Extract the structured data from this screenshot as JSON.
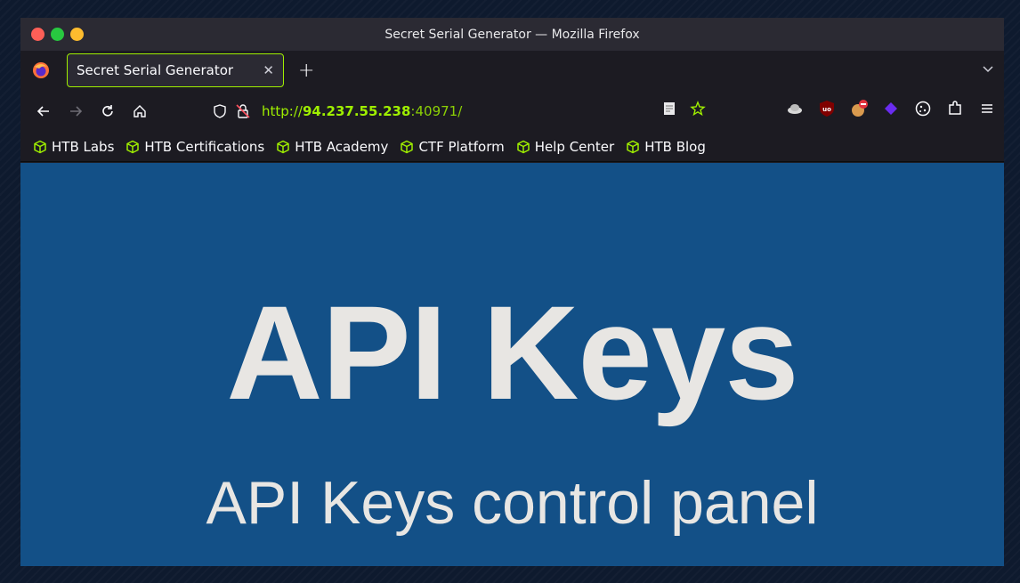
{
  "window": {
    "title": "Secret Serial Generator — Mozilla Firefox",
    "traffic_colors": [
      "#ff5f57",
      "#28c840",
      "#febc2e"
    ]
  },
  "tabs": [
    {
      "label": "Secret Serial Generator",
      "active": true
    }
  ],
  "address": {
    "scheme": "http://",
    "host": "94.237.55.238",
    "port_path": ":40971/"
  },
  "bookmarks": [
    {
      "label": "HTB Labs",
      "icon": "htb-cube-icon"
    },
    {
      "label": "HTB Certifications",
      "icon": "htb-cube-icon"
    },
    {
      "label": "HTB Academy",
      "icon": "htb-cube-icon"
    },
    {
      "label": "CTF Platform",
      "icon": "htb-cube-icon"
    },
    {
      "label": "Help Center",
      "icon": "htb-cube-icon"
    },
    {
      "label": "HTB Blog",
      "icon": "htb-cube-icon"
    }
  ],
  "page": {
    "heading": "API Keys",
    "subheading": "API Keys control panel",
    "background": "#135087",
    "text_color": "#e8e6e3"
  },
  "accent": "#9fef00"
}
